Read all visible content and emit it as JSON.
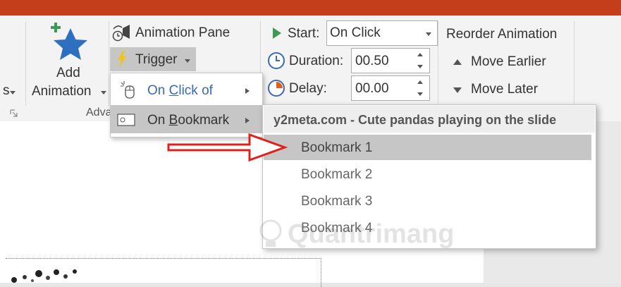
{
  "ribbon": {
    "add_animation_line1": "Add",
    "add_animation_line2": "Animation",
    "left_clip_char": "s",
    "group_label_advanced": "Adva",
    "animation_pane_label": "Animation Pane",
    "trigger_label": "Trigger",
    "start_label": "Start:",
    "start_value": "On Click",
    "duration_label": "Duration:",
    "duration_value": "00.50",
    "delay_label": "Delay:",
    "delay_value": "00.00",
    "reorder_title": "Reorder Animation",
    "move_earlier": "Move Earlier",
    "move_later": "Move Later"
  },
  "trigger_menu": {
    "on_click_of_pre": "On ",
    "on_click_of_key": "C",
    "on_click_of_post": "lick of",
    "on_bookmark_pre": "On ",
    "on_bookmark_key": "B",
    "on_bookmark_post": "ookmark"
  },
  "bookmark_submenu": {
    "header": "y2meta.com - Cute pandas playing on the slide",
    "items": [
      "Bookmark 1",
      "Bookmark 2",
      "Bookmark 3",
      "Bookmark 4"
    ]
  },
  "watermark": {
    "text": "Quantrimang"
  },
  "colors": {
    "titlebar": "#c43e1c",
    "star": "#2e6fc0",
    "plus": "#3d9a55",
    "highlight": "#c6c6c6",
    "arrow": "#e0201a",
    "trigger_bolt": "#f0c419"
  },
  "icons": [
    "add-animation-star-icon",
    "animation-pane-icon",
    "trigger-icon",
    "play-icon",
    "clock-icon",
    "delay-icon",
    "up-triangle-icon",
    "down-triangle-icon",
    "mouse-click-icon",
    "bookmark-icon",
    "chevron-right-icon",
    "red-arrow-icon"
  ]
}
